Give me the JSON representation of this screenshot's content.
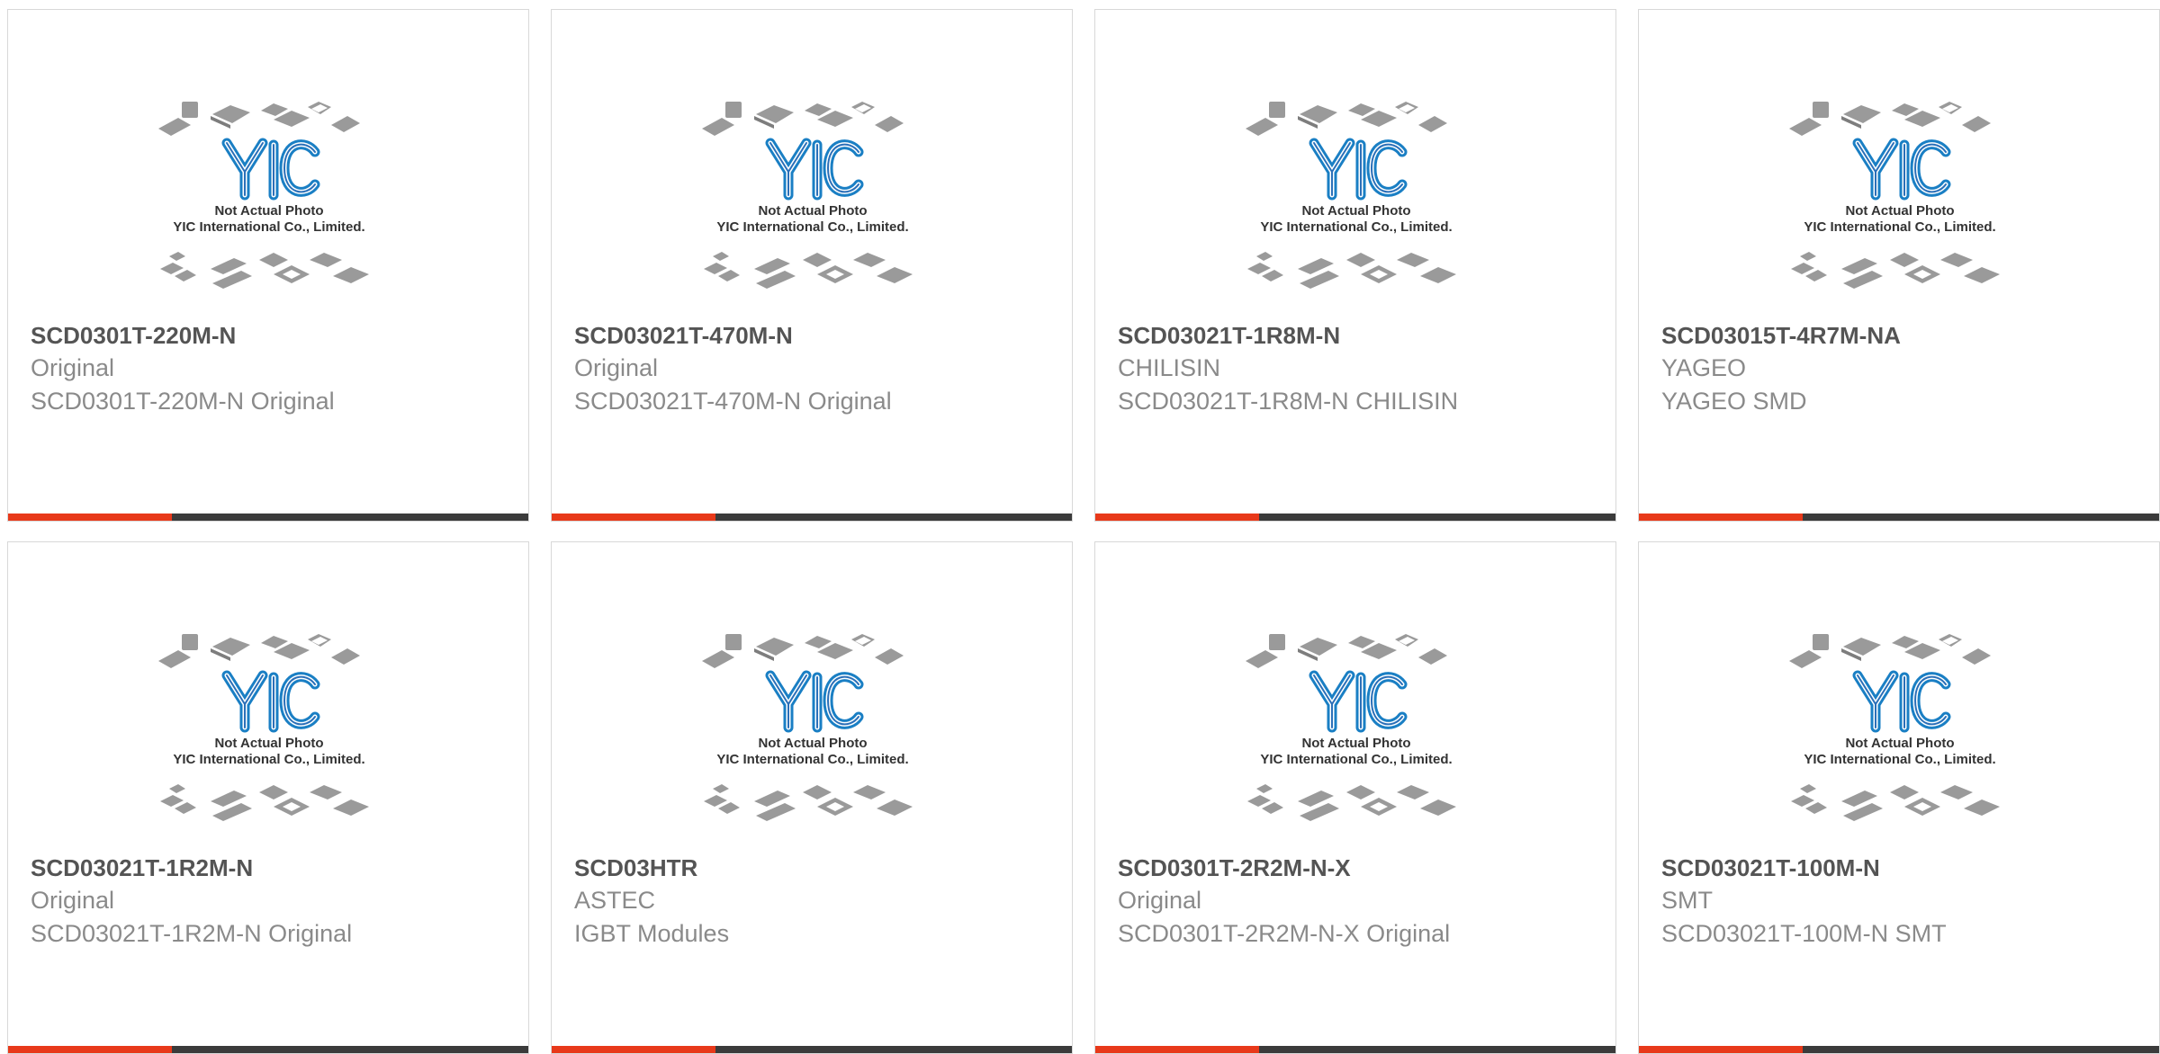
{
  "colors": {
    "accent": "#e8391a",
    "bar": "#3b3b3b",
    "title_text": "#545454",
    "meta_text": "#8a8a8a",
    "logo_blue": "#1a7fc4"
  },
  "placeholder": {
    "logo_text": "YIC",
    "caption_line1": "Not Actual Photo",
    "caption_line2": "YIC International Co., Limited."
  },
  "products": [
    {
      "part_number": "SCD0301T-220M-N",
      "brand": "Original",
      "description": "SCD0301T-220M-N Original"
    },
    {
      "part_number": "SCD03021T-470M-N",
      "brand": "Original",
      "description": "SCD03021T-470M-N Original"
    },
    {
      "part_number": "SCD03021T-1R8M-N",
      "brand": "CHILISIN",
      "description": "SCD03021T-1R8M-N CHILISIN"
    },
    {
      "part_number": "SCD03015T-4R7M-NA",
      "brand": "YAGEO",
      "description": "YAGEO SMD"
    },
    {
      "part_number": "SCD03021T-1R2M-N",
      "brand": "Original",
      "description": "SCD03021T-1R2M-N Original"
    },
    {
      "part_number": "SCD03HTR",
      "brand": "ASTEC",
      "description": "IGBT Modules"
    },
    {
      "part_number": "SCD0301T-2R2M-N-X",
      "brand": "Original",
      "description": "SCD0301T-2R2M-N-X Original"
    },
    {
      "part_number": "SCD03021T-100M-N",
      "brand": "SMT",
      "description": "SCD03021T-100M-N SMT"
    }
  ]
}
